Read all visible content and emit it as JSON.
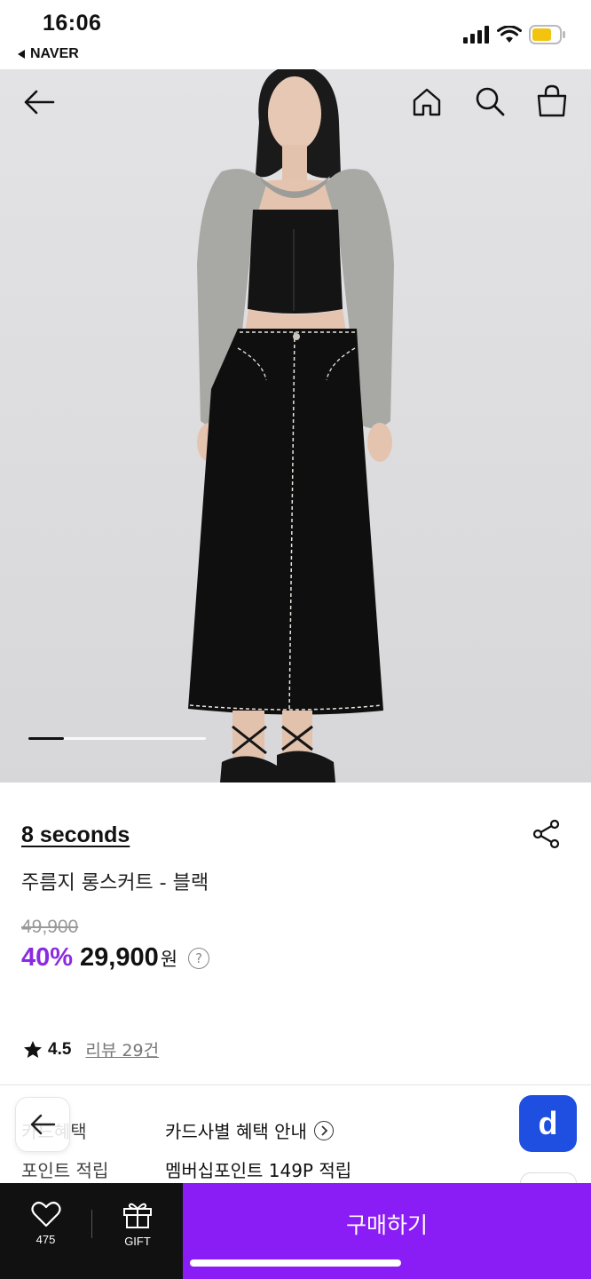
{
  "status_bar": {
    "time": "16:06",
    "back_app": "NAVER",
    "icons": [
      "signal-icon",
      "wifi-icon",
      "battery-icon"
    ]
  },
  "top_nav": {
    "icons": [
      "back-arrow-icon",
      "home-icon",
      "search-icon",
      "shopping-bag-icon"
    ]
  },
  "gallery": {
    "progress": 0.2
  },
  "product": {
    "brand": "8 seconds",
    "name": "주름지 롱스커트 - 블랙",
    "original_price": "49,900",
    "discount": "40%",
    "price": "29,900",
    "currency": "원",
    "help_icon_text": "?",
    "rating": "4.5",
    "reviews": "리뷰 29건"
  },
  "benefits": [
    {
      "label": "카드혜택",
      "value": "카드사별 혜택 안내"
    },
    {
      "label": "포인트 적립",
      "value": "멤버십포인트 149P 적립"
    }
  ],
  "floating": {
    "d_label": "d"
  },
  "bottom_bar": {
    "like_count": "475",
    "gift_label": "GIFT",
    "buy_label": "구매하기"
  },
  "colors": {
    "accent_purple": "#8a1cf5",
    "discount_purple": "#8a2be2",
    "d_button_blue": "#1f4fe0",
    "bottom_bar": "#111111"
  }
}
